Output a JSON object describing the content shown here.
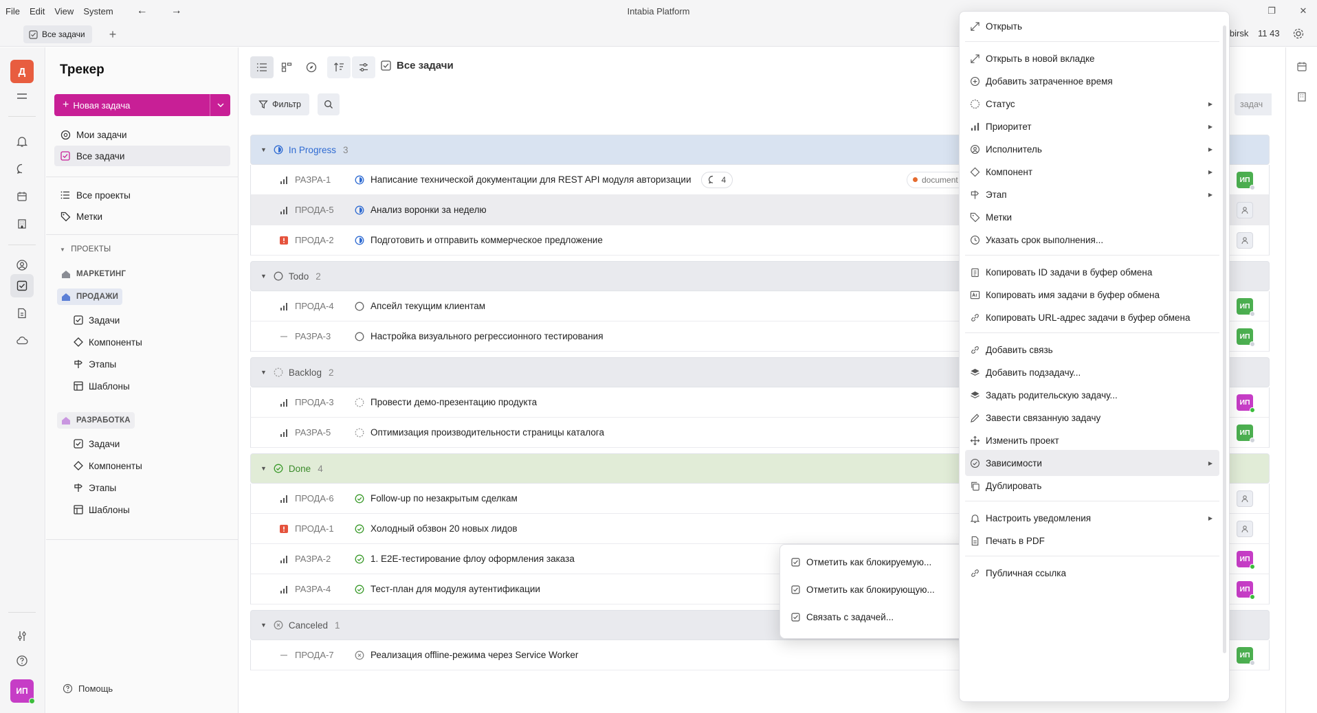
{
  "menubar": [
    "File",
    "Edit",
    "View",
    "System"
  ],
  "app_title": "Intabia Platform",
  "tab": {
    "label": "Все задачи"
  },
  "topbar_right": {
    "timezone": "ibirsk",
    "time": "11 43"
  },
  "sidebar": {
    "title": "Трекер",
    "new_task_label": "Новая задача",
    "items": [
      {
        "label": "Мои задачи"
      },
      {
        "label": "Все задачи"
      },
      {
        "label": "Все проекты"
      },
      {
        "label": "Метки"
      }
    ],
    "projects_header": "ПРОЕКТЫ",
    "projects": [
      {
        "name": "МАРКЕТИНГ",
        "color": "#8a8d95"
      },
      {
        "name": "ПРОДАЖИ",
        "color": "#5b7fd6",
        "children": [
          "Задачи",
          "Компоненты",
          "Этапы",
          "Шаблоны"
        ]
      },
      {
        "name": "РАЗРАБОТКА",
        "color": "#c996e0",
        "children": [
          "Задачи",
          "Компоненты",
          "Этапы",
          "Шаблоны"
        ]
      }
    ],
    "help_label": "Помощь"
  },
  "main": {
    "view_title": "Все задачи",
    "filter_label": "Фильтр",
    "ext_chip_label": "задач",
    "groups": [
      {
        "name": "In Progress",
        "count": "3",
        "bg": "#d9e3f1",
        "color": "#2f6bd2"
      },
      {
        "name": "Todo",
        "count": "2",
        "bg": "#e9eaee",
        "color": "#555"
      },
      {
        "name": "Backlog",
        "count": "2",
        "bg": "#e9eaee",
        "color": "#555"
      },
      {
        "name": "Done",
        "count": "4",
        "bg": "#e1ecd7",
        "color": "#3a8a2a"
      },
      {
        "name": "Canceled",
        "count": "1",
        "bg": "#e9eaee",
        "color": "#555"
      }
    ],
    "rows": [
      {
        "id": "РАЗРА-1",
        "title": "Написание технической документации для REST API модуля авторизации",
        "comments": "4",
        "label": "document",
        "priority": "bars",
        "status": "progress",
        "avatar": "ИП",
        "avatar_style": "green"
      },
      {
        "id": "ПРОДА-5",
        "title": "Анализ воронки за неделю",
        "priority": "bars",
        "status": "progress",
        "avatar": "",
        "avatar_style": "empty"
      },
      {
        "id": "ПРОДА-2",
        "title": "Подготовить и отправить коммерческое предложение",
        "priority": "urgent",
        "status": "progress",
        "avatar": "",
        "avatar_style": "empty"
      },
      {
        "id": "ПРОДА-4",
        "title": "Апсейл текущим клиентам",
        "priority": "bars",
        "status": "todo",
        "avatar": "ИП",
        "avatar_style": "green"
      },
      {
        "id": "РАЗРА-3",
        "title": "Настройка визуального регрессионного тестирования",
        "priority": "none",
        "status": "todo",
        "avatar": "ИП",
        "avatar_style": "green"
      },
      {
        "id": "ПРОДА-3",
        "title": "Провести демо-презентацию продукта",
        "priority": "bars",
        "status": "backlog",
        "avatar": "ИП",
        "avatar_style": "pink"
      },
      {
        "id": "РАЗРА-5",
        "title": "Оптимизация производительности страницы каталога",
        "priority": "bars",
        "status": "backlog",
        "avatar": "ИП",
        "avatar_style": "green"
      },
      {
        "id": "ПРОДА-6",
        "title": "Follow-up по незакрытым сделкам",
        "priority": "bars",
        "status": "done",
        "avatar": "",
        "avatar_style": "empty"
      },
      {
        "id": "ПРОДА-1",
        "title": "Холодный обзвон 20 новых лидов",
        "priority": "urgent",
        "status": "done",
        "avatar": "",
        "avatar_style": "empty"
      },
      {
        "id": "РАЗРА-2",
        "title": "1. E2E-тестирование флоу оформления заказа",
        "priority": "bars",
        "status": "done",
        "avatar": "ИП",
        "avatar_style": "pink"
      },
      {
        "id": "РАЗРА-4",
        "title": "Тест-план для модуля аутентификации",
        "priority": "bars",
        "status": "done",
        "avatar": "ИП",
        "avatar_style": "pink"
      },
      {
        "id": "ПРОДА-7",
        "title": "Реализация offline-режима через Service Worker",
        "priority": "none",
        "status": "canceled",
        "avatar": "ИП",
        "avatar_style": "green"
      }
    ]
  },
  "context_menu": [
    {
      "label": "Открыть",
      "icon": "expand-icon"
    },
    {
      "label": "Открыть в новой вкладке",
      "icon": "expand-icon"
    },
    {
      "label": "Добавить затраченное время",
      "icon": "plus-circle-icon"
    },
    {
      "label": "Статус",
      "icon": "status-icon",
      "submenu": true
    },
    {
      "label": "Приоритет",
      "icon": "priority-icon",
      "submenu": true
    },
    {
      "label": "Исполнитель",
      "icon": "person-icon",
      "submenu": true
    },
    {
      "label": "Компонент",
      "icon": "diamond-icon",
      "submenu": true
    },
    {
      "label": "Этап",
      "icon": "signpost-icon",
      "submenu": true
    },
    {
      "label": "Метки",
      "icon": "tag-icon"
    },
    {
      "label": "Указать срок выполнения...",
      "icon": "clock-icon"
    },
    {
      "label": "Копировать ID задачи в буфер обмена",
      "icon": "clipboard-icon"
    },
    {
      "label": "Копировать имя задачи в буфер обмена",
      "icon": "text-icon"
    },
    {
      "label": "Копировать URL-адрес задачи в буфер обмена",
      "icon": "link-icon"
    },
    {
      "label": "Добавить связь",
      "icon": "link-icon"
    },
    {
      "label": "Добавить подзадачу...",
      "icon": "layers-icon"
    },
    {
      "label": "Задать родительскую задачу...",
      "icon": "layers-icon"
    },
    {
      "label": "Завести связанную задачу",
      "icon": "pencil-icon"
    },
    {
      "label": "Изменить проект",
      "icon": "move-icon"
    },
    {
      "label": "Зависимости",
      "icon": "check-circle-icon",
      "submenu": true
    },
    {
      "label": "Дублировать",
      "icon": "copy-icon"
    },
    {
      "label": "Настроить уведомления",
      "icon": "bell-icon",
      "submenu": true
    },
    {
      "label": "Печать в PDF",
      "icon": "document-icon"
    },
    {
      "label": "Публичная ссылка",
      "icon": "link-icon"
    }
  ],
  "dependency_submenu": [
    {
      "label": "Отметить как блокируемую..."
    },
    {
      "label": "Отметить как блокирующую..."
    },
    {
      "label": "Связать с задачей..."
    }
  ]
}
